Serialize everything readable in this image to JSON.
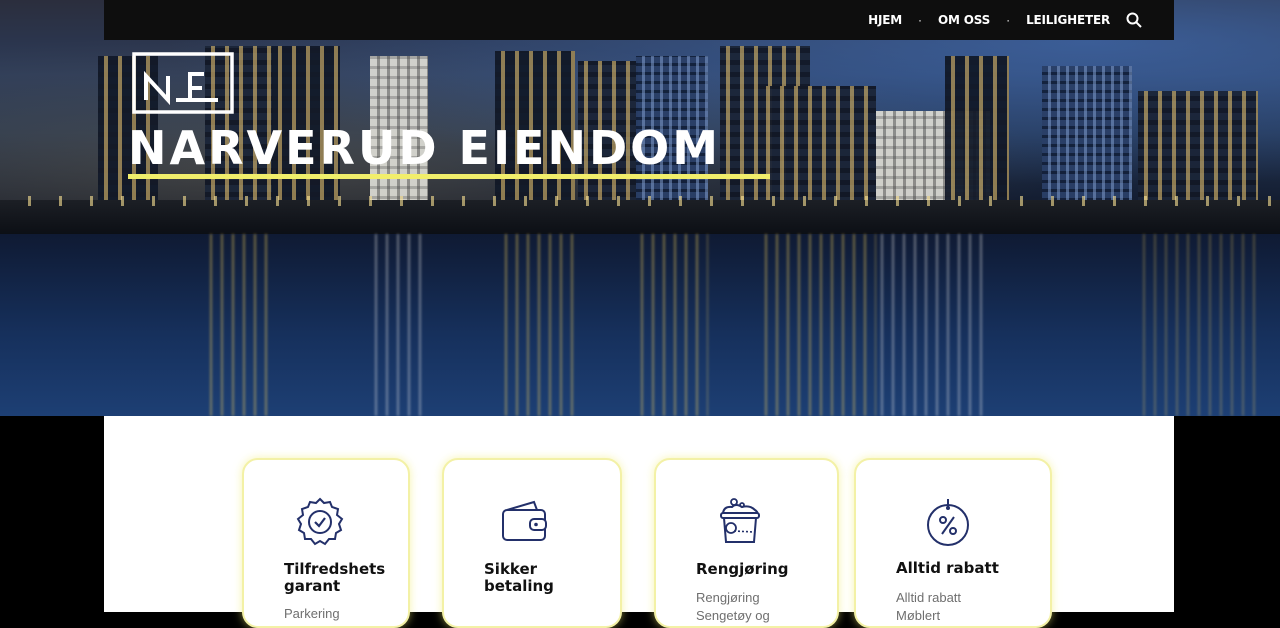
{
  "nav": {
    "items": [
      {
        "label": "HJEM"
      },
      {
        "label": "OM OSS"
      },
      {
        "label": "LEILIGHETER"
      }
    ],
    "search_icon": "search-icon"
  },
  "hero": {
    "title": "NARVERUD EIENDOM",
    "logo_icon": "ne-logo-mark",
    "accent_color": "#f1ee6b"
  },
  "features": [
    {
      "icon": "badge-check-icon",
      "title_line1": "Tilfredshets",
      "title_line2": "garant",
      "items": [
        "Parkering"
      ]
    },
    {
      "icon": "wallet-icon",
      "title_line1": "Sikker",
      "title_line2": "betaling",
      "items": []
    },
    {
      "icon": "laundry-basket-icon",
      "title_line1": "Rengjøring",
      "title_line2": "",
      "items": [
        "Rengjøring",
        "Sengetøy og"
      ]
    },
    {
      "icon": "discount-tag-icon",
      "title_line1": "Alltid rabatt",
      "title_line2": "",
      "items": [
        "Alltid rabatt",
        "Møblert"
      ]
    }
  ]
}
